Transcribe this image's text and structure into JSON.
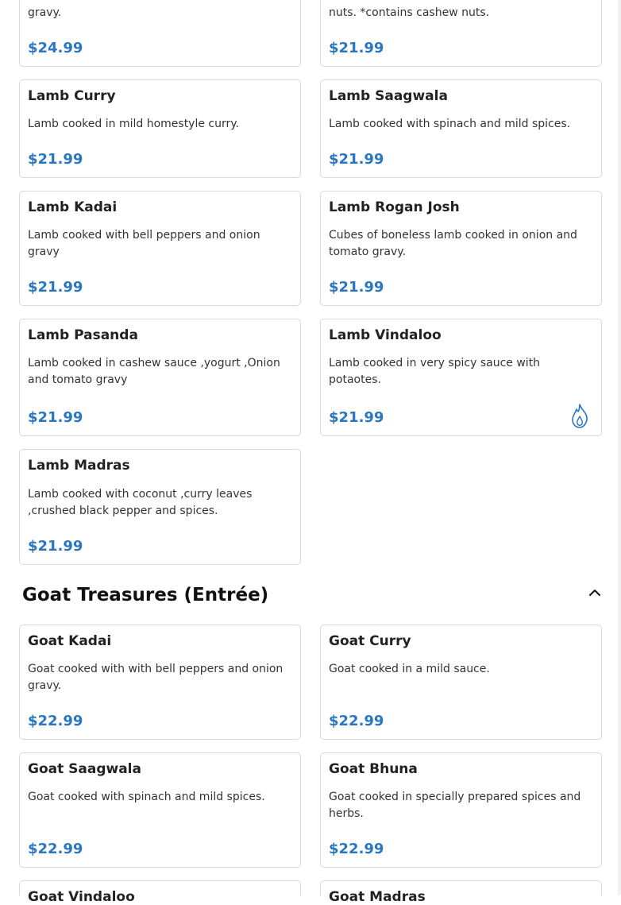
{
  "top_cards": [
    {
      "desc": "gravy.",
      "price": "$24.99"
    },
    {
      "desc": "nuts. *contains cashew nuts.",
      "price": "$21.99"
    }
  ],
  "lamb_items": [
    {
      "name": "Lamb Curry",
      "desc": "Lamb cooked in mild homestyle curry.",
      "price": "$21.99"
    },
    {
      "name": "Lamb Saagwala",
      "desc": "Lamb cooked with spinach and mild spices.",
      "price": "$21.99"
    },
    {
      "name": "Lamb Kadai",
      "desc": "Lamb cooked with bell peppers and onion gravy",
      "price": "$21.99"
    },
    {
      "name": "Lamb Rogan Josh",
      "desc": "Cubes of boneless lamb cooked in onion and tomato gravy.",
      "price": "$21.99"
    },
    {
      "name": "Lamb Pasanda",
      "desc": "Lamb cooked in cashew sauce ,yogurt ,Onion and tomato gravy",
      "price": "$21.99"
    },
    {
      "name": "Lamb Vindaloo",
      "desc": "Lamb cooked in very spicy sauce with potaotes.",
      "price": "$21.99",
      "icon": "spicy-flame-icon"
    },
    {
      "name": "Lamb Madras",
      "desc": "Lamb cooked with coconut ,curry leaves ,crushed black pepper and spices.",
      "price": "$21.99"
    }
  ],
  "goat_section": {
    "title": "Goat Treasures (Entrée)",
    "toggle_icon": "chevron-up-icon"
  },
  "goat_items": [
    {
      "name": "Goat Kadai",
      "desc": "Goat cooked with with bell peppers and onion gravy.",
      "price": "$22.99"
    },
    {
      "name": "Goat Curry",
      "desc": "Goat cooked in a mild sauce.",
      "price": "$22.99"
    },
    {
      "name": "Goat Saagwala",
      "desc": "Goat cooked with spinach and mild spices.",
      "price": "$22.99"
    },
    {
      "name": "Goat Bhuna",
      "desc": "Goat cooked in specially prepared spices and herbs.",
      "price": "$22.99"
    },
    {
      "name": "Goat Vindaloo"
    },
    {
      "name": "Goat Madras"
    }
  ],
  "colors": {
    "price": "#2a76c0",
    "border": "#d9d9d9",
    "spicy_icon": "#2a76c0"
  }
}
